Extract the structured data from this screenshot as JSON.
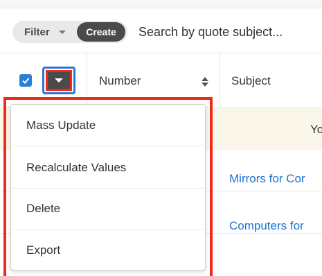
{
  "toolbar": {
    "filter_label": "Filter",
    "create_label": "Create",
    "search_placeholder": "Search by quote subject..."
  },
  "table": {
    "columns": [
      {
        "label": "Number",
        "sortable": true
      },
      {
        "label": "Subject"
      }
    ],
    "notice_text": "Yo",
    "rows": [
      {
        "subject": "Mirrors for Cor"
      },
      {
        "subject": "Computers for"
      }
    ]
  },
  "mass_actions_menu": {
    "items": [
      {
        "label": "Mass Update"
      },
      {
        "label": "Recalculate Values"
      },
      {
        "label": "Delete"
      },
      {
        "label": "Export"
      }
    ]
  },
  "colors": {
    "accent": "#2a7fd3",
    "highlight": "#ef2a1b",
    "link": "#1a73d0",
    "notice_bg": "#fbf6ea"
  }
}
